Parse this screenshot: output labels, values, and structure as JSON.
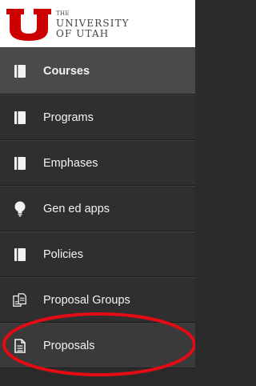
{
  "logo": {
    "the": "THE",
    "line1": "UNIVERSITY",
    "line2": "OF UTAH",
    "brand_color": "#cc0000"
  },
  "nav": {
    "items": [
      {
        "label": "Courses",
        "icon": "book-icon",
        "active": true
      },
      {
        "label": "Programs",
        "icon": "book-icon"
      },
      {
        "label": "Emphases",
        "icon": "book-icon"
      },
      {
        "label": "Gen ed apps",
        "icon": "lightbulb-icon"
      },
      {
        "label": "Policies",
        "icon": "book-icon"
      },
      {
        "label": "Proposal Groups",
        "icon": "documents-icon"
      },
      {
        "label": "Proposals",
        "icon": "document-icon",
        "highlighted": true
      }
    ]
  },
  "annotation": {
    "color": "#e30b14",
    "target": "Proposals"
  }
}
